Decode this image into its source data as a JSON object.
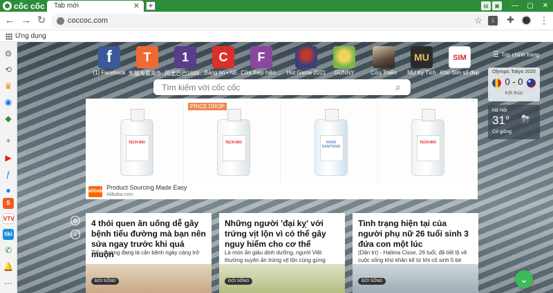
{
  "browser": {
    "brand": "cốc cốc",
    "tab_title": "Tab mới",
    "new_tab": "+",
    "url": "coccoc.com",
    "bookmarks_apps_label": "Ứng dụng"
  },
  "speed_dial": [
    {
      "label": "(1) Facebook",
      "glyph": "f",
      "color": "#3b5998"
    },
    {
      "label": "天貓淘寶海外...",
      "glyph": "T",
      "color": "#ef6a32"
    },
    {
      "label": "阿里巴巴1688....",
      "glyph": "1",
      "color": "#5a3b8c"
    },
    {
      "label": "Bảng tin • NE...",
      "glyph": "C",
      "color": "#d9302b"
    },
    {
      "label": "Cửa thép hiện ...",
      "glyph": "F",
      "color": "#8a47a0"
    },
    {
      "label": "Hot Game 2021",
      "glyph": "",
      "color": "#3a3f7a"
    },
    {
      "label": "GUNNY",
      "glyph": "",
      "color": "#7ab648"
    },
    {
      "label": "Cửu Thiên",
      "glyph": "",
      "color": "#5a4a3e"
    },
    {
      "label": "MU Kỳ Tích",
      "glyph": "MU",
      "color": "#2b2b2b"
    },
    {
      "label": "Kho Sim số đẹp",
      "glyph": "SIM",
      "color": "#d62828"
    }
  ],
  "customize_label": "Tùy chỉnh trang",
  "search": {
    "placeholder": "Tìm kiếm với cốc cốc"
  },
  "ad": {
    "badge": "PRICE DROP",
    "bottle_text": "TECH-BIO",
    "bottle_text_alt": "HAND SANITIZER",
    "title": "Product Sourcing Made Easy",
    "domain": "Alibaba.com",
    "logo": "alibaba"
  },
  "widgets": {
    "olympic": {
      "title": "Olympic Tokyo 2020",
      "score": "0 - 0",
      "status": "Kết thúc"
    },
    "weather": {
      "city": "Hà Nội",
      "temp": "31°",
      "desc": "Có giông"
    }
  },
  "news": [
    {
      "title": "4 thói quen ăn uống dễ gây bệnh tiểu đường mà bạn nên sửa ngay trước khi quá muộn",
      "summary": "Tiểu đường đang là căn bệnh ngày càng trở",
      "tag": "ĐỜI SỐNG",
      "img": "#d9c4a9"
    },
    {
      "title": "Những người 'đại kỵ' với trứng vịt lộn vì có thể gây nguy hiểm cho cơ thể",
      "summary": "Là món ăn giàu dinh dưỡng, người Việt thường xuyên ăn trứng vịt lộn cùng gừng",
      "tag": "ĐỜI SỐNG",
      "img": "#c9cf9e"
    },
    {
      "title": "Tình trạng hiện tại của người phụ nữ 26 tuổi sinh 3 đứa con một lúc",
      "summary": "(Dân trí) - Halima Cisse, 26 tuổi, đã tiết lộ về cuộc sống khó khăn kể từ khi cô sinh 5 bé",
      "tag": "ĐỜI SỐNG",
      "img": "#b9c4cc"
    }
  ]
}
